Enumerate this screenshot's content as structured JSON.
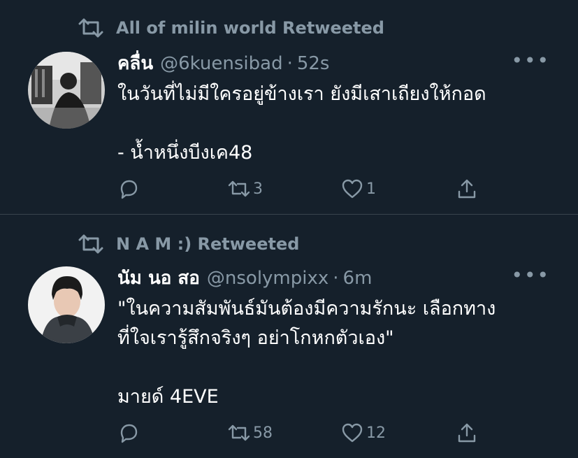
{
  "tweets": [
    {
      "retweeted_by": "All of milin world Retweeted",
      "name": "คลื่น",
      "handle": "@6kuensibad",
      "time": "52s",
      "text": "ในวันที่ไม่มีใครอยู่ข้างเรา ยังมีเสาเถียงให้กอด\n\n- น้ำหนึ่งบีงเค48",
      "retweets": "3",
      "likes": "1"
    },
    {
      "retweeted_by": "N A M :) Retweeted",
      "name": "นัม นอ สอ",
      "handle": "@nsolympixx",
      "time": "6m",
      "text": "\"ในความสัมพันธ์มันต้องมีความรักนะ เลือกทาง\nที่ใจเรารู้สึกจริงๆ อย่าโกหกตัวเอง\"\n\nมายด์ 4EVE",
      "retweets": "58",
      "likes": "12"
    }
  ],
  "icons": {
    "retweet": "retweet-icon",
    "reply": "reply-icon",
    "like": "heart-icon",
    "share": "share-icon",
    "more": "more-icon"
  },
  "colors": {
    "background": "#15202b",
    "secondary_text": "#8899a6",
    "divider": "#38444d"
  }
}
